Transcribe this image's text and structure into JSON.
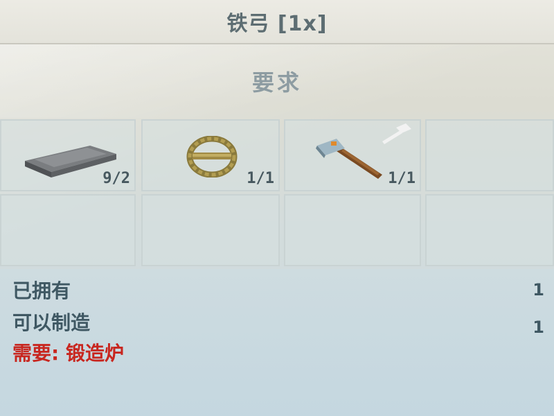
{
  "title": "铁弓 [1x]",
  "requirements_header": "要求",
  "ingredients": [
    {
      "icon": "iron-bar-icon",
      "count": "9/2"
    },
    {
      "icon": "rope-coil-icon",
      "count": "1/1"
    },
    {
      "icon": "hammer-icon",
      "count": "1/1"
    }
  ],
  "info": {
    "owned_label": "已拥有",
    "owned_value": "1",
    "craftable_label": "可以制造",
    "craftable_value": "1",
    "requires_station": "需要: 锻造炉"
  },
  "colors": {
    "title_text": "#5d6d72",
    "count_text": "#47585f",
    "info_text": "#3f5863",
    "warning_text": "#c8261f"
  }
}
